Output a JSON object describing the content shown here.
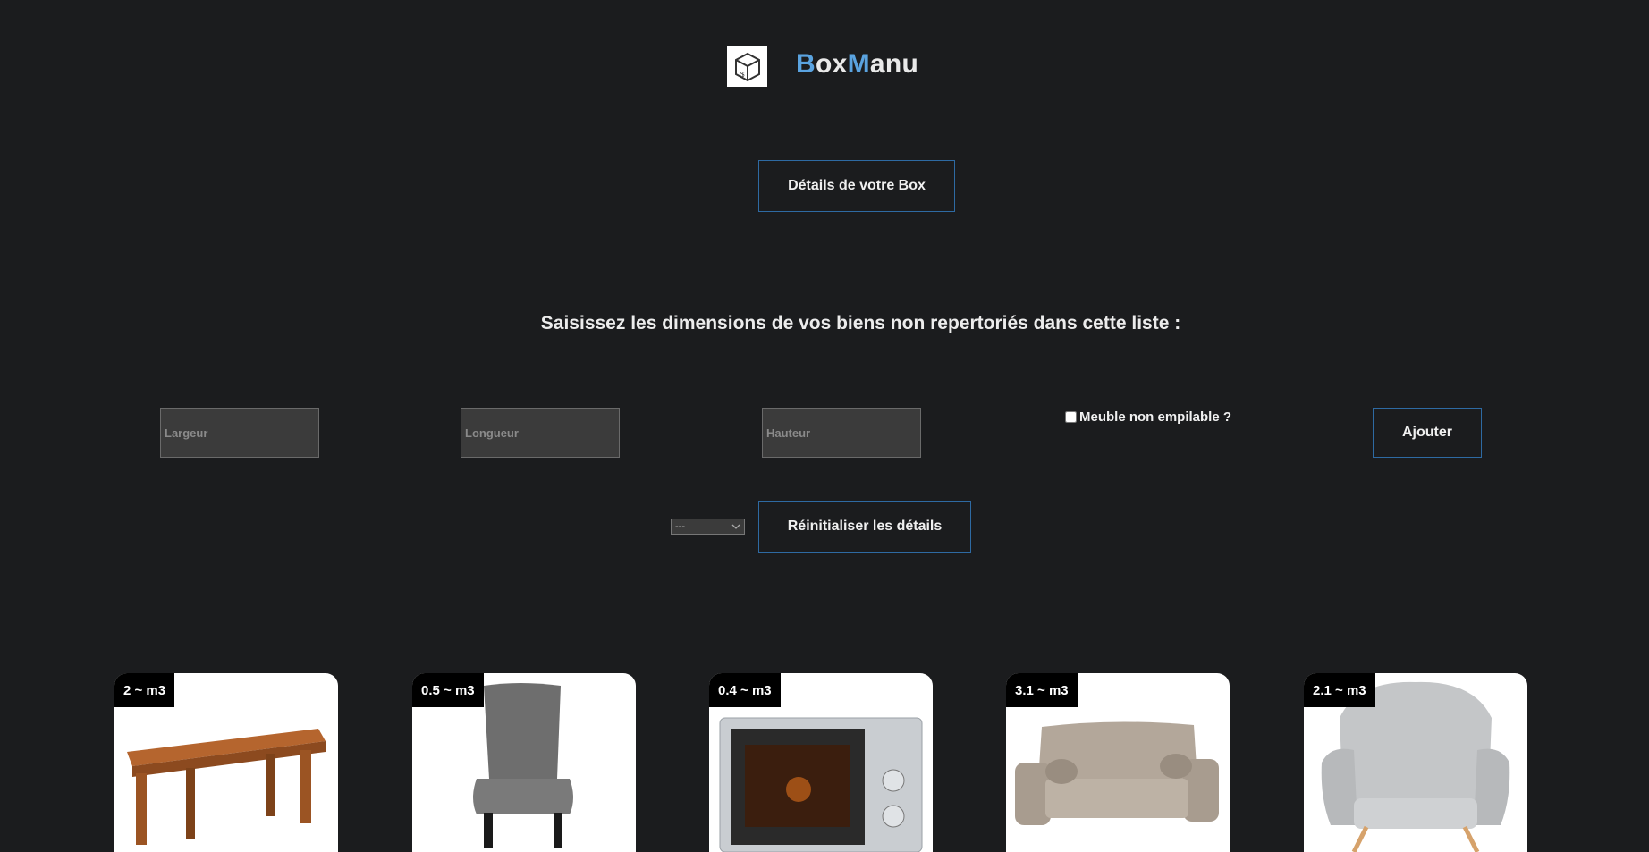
{
  "brand": {
    "part1_accent": "B",
    "part1": "ox",
    "part2_accent": "M",
    "part2": "anu"
  },
  "buttons": {
    "details": "Détails de votre Box",
    "add": "Ajouter",
    "reset": "Réinitialiser les détails"
  },
  "instructions": "Saisissez les dimensions de vos biens non repertoriés dans cette liste :",
  "inputs": {
    "largeur_placeholder": "Largeur",
    "longueur_placeholder": "Longueur",
    "hauteur_placeholder": "Hauteur"
  },
  "stackable_label": "Meuble non empilable ?",
  "select": {
    "value": "---"
  },
  "items": [
    {
      "volume": "2 ~ m3",
      "icon": "table-icon"
    },
    {
      "volume": "0.5 ~ m3",
      "icon": "chair-icon"
    },
    {
      "volume": "0.4 ~ m3",
      "icon": "microwave-icon"
    },
    {
      "volume": "3.1 ~ m3",
      "icon": "sofa-icon"
    },
    {
      "volume": "2.1 ~ m3",
      "icon": "armchair-icon"
    }
  ],
  "colors": {
    "accent": "#5aa3e0",
    "button_border": "#2e6aa3",
    "background": "#1b1c1e"
  }
}
